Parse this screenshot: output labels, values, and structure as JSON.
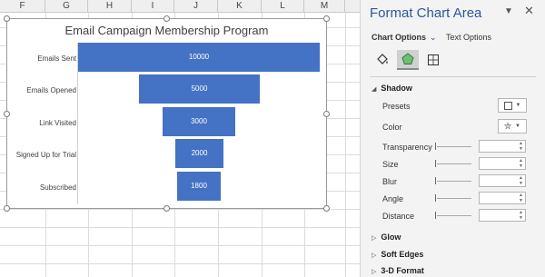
{
  "sheet": {
    "columns": [
      "F",
      "G",
      "H",
      "I",
      "J",
      "K",
      "L",
      "M"
    ]
  },
  "chart": {
    "title": "Email Campaign Membership Program"
  },
  "chart_data": {
    "type": "bar",
    "orientation": "horizontal-funnel",
    "title": "Email Campaign Membership Program",
    "categories": [
      "Emails Sent",
      "Emails Opened",
      "Link Visited",
      "Signed Up for Trial",
      "Subscribed"
    ],
    "values": [
      10000,
      5000,
      3000,
      2000,
      1800
    ],
    "data_labels": [
      "10000",
      "5000",
      "3000",
      "2000",
      "1800"
    ],
    "bar_color": "#4472C4",
    "xlabel": "",
    "ylabel": "",
    "grid": false,
    "legend": "none"
  },
  "pane": {
    "title": "Format Chart Area",
    "tabs": {
      "chart_options": "Chart Options",
      "text_options": "Text Options"
    },
    "icons": [
      "fill-line-icon",
      "effects-icon",
      "size-properties-icon"
    ],
    "sections": {
      "shadow": "Shadow",
      "glow": "Glow",
      "soft_edges": "Soft Edges",
      "three_d_format": "3-D Format"
    },
    "properties": {
      "presets": "Presets",
      "color": "Color",
      "transparency": "Transparency",
      "size": "Size",
      "blur": "Blur",
      "angle": "Angle",
      "distance": "Distance"
    }
  },
  "colors": {
    "accent": "#2B579A",
    "bar": "#4472C4",
    "pane_bg": "#F3F3F3"
  }
}
